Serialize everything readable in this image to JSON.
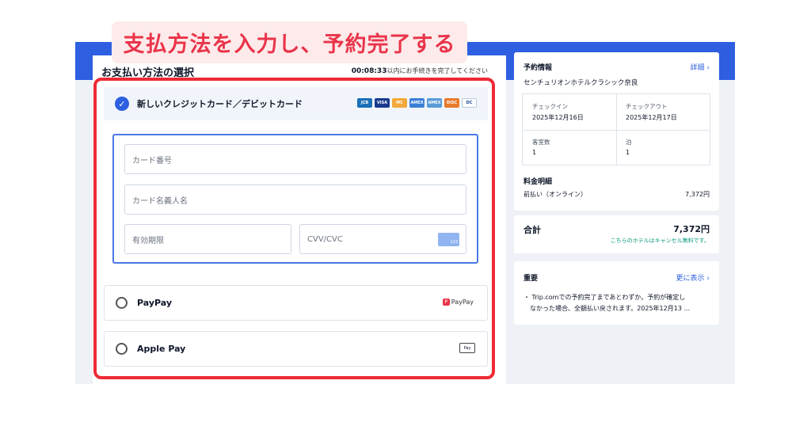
{
  "banner": "支払方法を入力し、予約完了する",
  "payment": {
    "title": "お支払い方法の選択",
    "timer_value": "00:08:33",
    "timer_suffix": "以内にお手続きを完了してください",
    "new_card_label": "新しいクレジットカード／デビットカード",
    "card_brands": [
      "JCB",
      "VISA",
      "MC",
      "AMEX",
      "AMEX",
      "DISC",
      "DC"
    ],
    "card_number_placeholder": "カード番号",
    "cardholder_placeholder": "カード名義人名",
    "expiry_placeholder": "有効期限",
    "cvv_placeholder": "CVV/CVC",
    "cvv_hint": "123",
    "paypay_label": "PayPay",
    "paypay_logo": "PayPay",
    "applepay_label": "Apple Pay",
    "applepay_logo": "Pay"
  },
  "reservation": {
    "title": "予約情報",
    "details_link": "詳細 ›",
    "hotel": "センチュリオンホテルクラシック奈良",
    "checkin_label": "チェックイン",
    "checkin_value": "2025年12月16日",
    "checkout_label": "チェックアウト",
    "checkout_value": "2025年12月17日",
    "rooms_label": "客室数",
    "rooms_value": "1",
    "nights_label": "泊",
    "nights_value": "1",
    "breakdown_title": "料金明細",
    "prepay_label": "前払い（オンライン）",
    "prepay_value": "7,372円"
  },
  "total": {
    "label": "合計",
    "value": "7,372円",
    "note": "こちらのホテルはキャンセル無料です。"
  },
  "important": {
    "title": "重要",
    "more_link": "更に表示 ›",
    "text_line1": "・ Trip.comでの予約完了まであとわずか。予約が確定し",
    "text_line2": "　なかった場合、全額払い戻されます。2025年12月13 ..."
  },
  "colors": {
    "accent": "#2e5fe0",
    "alert": "#ee2a36",
    "success": "#0a9b7d"
  }
}
